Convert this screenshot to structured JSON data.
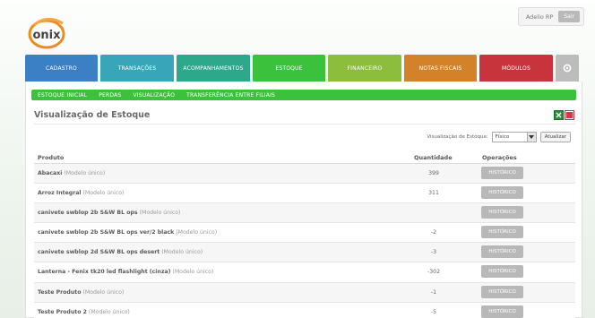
{
  "header": {
    "logo_text": "onix",
    "user_name": "Adelio RP",
    "logout_label": "Sair"
  },
  "colors": {
    "cadastro": "#3b7fc4",
    "transacoes": "#38a6b8",
    "acompanhamentos": "#2ea88a",
    "estoque": "#3cc13c",
    "financeiro": "#8cbd3c",
    "notas_fiscais": "#d4822a",
    "modulos": "#c8343c"
  },
  "main_nav": {
    "items": [
      {
        "label": "Cadastro"
      },
      {
        "label": "Transações"
      },
      {
        "label": "Acompanhamentos"
      },
      {
        "label": "Estoque"
      },
      {
        "label": "Financeiro"
      },
      {
        "label": "Notas Fiscais"
      },
      {
        "label": "Módulos"
      }
    ],
    "gear_icon": "gear-icon"
  },
  "sub_nav": {
    "items": [
      {
        "label": "Estoque Inicial"
      },
      {
        "label": "Perdas"
      },
      {
        "label": "Visualização"
      },
      {
        "label": "Transferência entre filiais"
      }
    ]
  },
  "page": {
    "title": "Visualização de Estoque",
    "export_icons": [
      "excel-icon",
      "pdf-icon"
    ]
  },
  "filter": {
    "label": "Visualização de Estoque:",
    "selected": "Físico",
    "update_label": "Atualizar"
  },
  "table": {
    "headers": {
      "product": "Produto",
      "quantity": "Quantidade",
      "operations": "Operações"
    },
    "rows": [
      {
        "name": "Abacaxi",
        "model": "(Modelo único)",
        "qty": "399",
        "action": "Histórico"
      },
      {
        "name": "Arroz Integral",
        "model": "(Modelo único)",
        "qty": "311",
        "action": "Histórico"
      },
      {
        "name": "canivete swblop 2b S&W BL ops",
        "model": "(Modelo único)",
        "qty": "",
        "action": "Histórico"
      },
      {
        "name": "canivete swblop 2b S&W BL ops ver/2 black",
        "model": "(Modelo único)",
        "qty": "-2",
        "action": "Histórico"
      },
      {
        "name": "canivete swblop 2d S&W BL ops desert",
        "model": "(Modelo único)",
        "qty": "-3",
        "action": "Histórico"
      },
      {
        "name": "Lanterna - Fenix tk20 led flashlight (cinza)",
        "model": "(Modelo único)",
        "qty": "-302",
        "action": "Histórico"
      },
      {
        "name": "Teste Produto",
        "model": "(Modelo único)",
        "qty": "-1",
        "action": "Histórico"
      },
      {
        "name": "Teste Produto 2",
        "model": "(Modelo único)",
        "qty": "-5",
        "action": "Histórico"
      }
    ]
  }
}
